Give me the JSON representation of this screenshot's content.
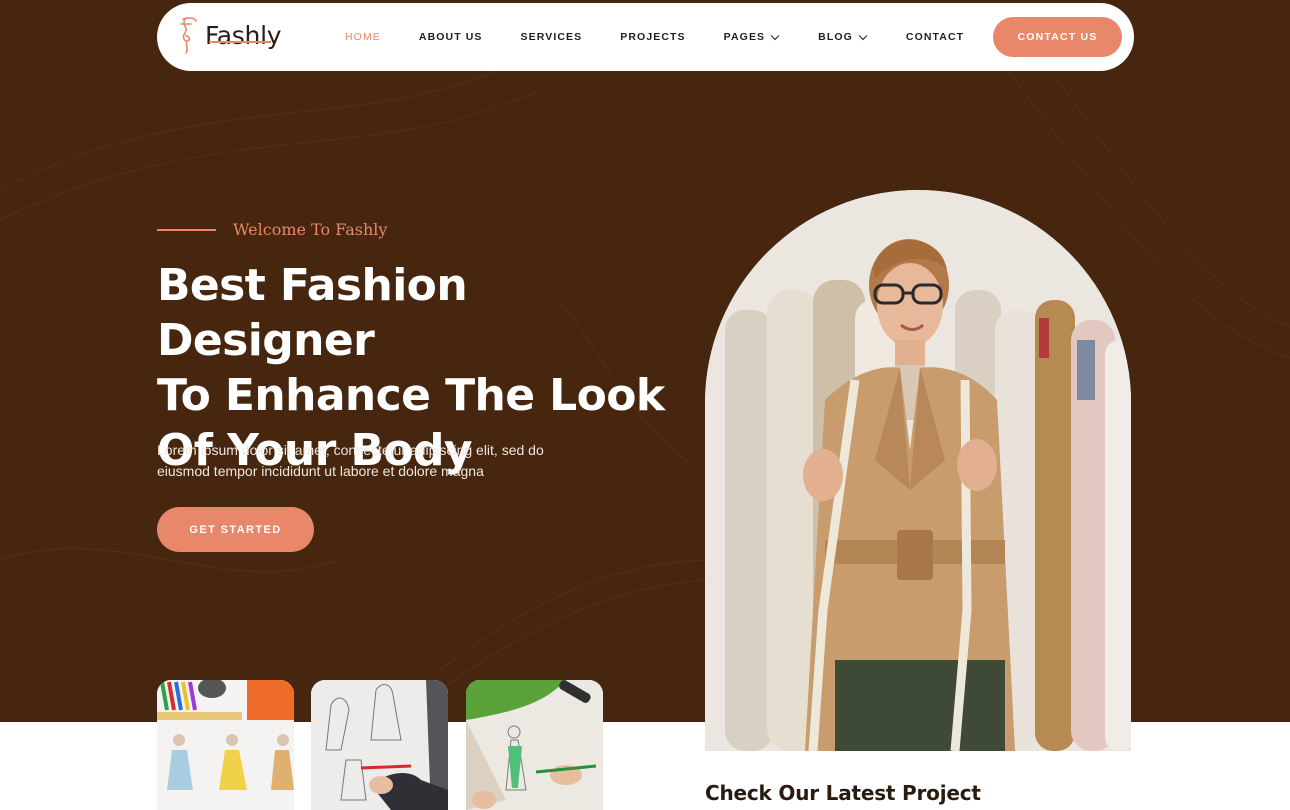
{
  "brand": {
    "name": "Fashly"
  },
  "nav": {
    "items": [
      {
        "label": "HOME",
        "active": true
      },
      {
        "label": "ABOUT US"
      },
      {
        "label": "SERVICES"
      },
      {
        "label": "PROJECTS"
      },
      {
        "label": "PAGES",
        "dropdown": true
      },
      {
        "label": "BLOG",
        "dropdown": true
      },
      {
        "label": "CONTACT"
      }
    ],
    "cta_label": "CONTACT US"
  },
  "hero": {
    "eyebrow": "Welcome To Fashly",
    "headline_lines": [
      "Best Fashion Designer",
      "To Enhance The Look",
      "Of Your Body"
    ],
    "subtext_lines": [
      "Lorem ipsum dolor sit amet, consectetur adipiscing elit, sed do",
      "eiusmod tempor incididunt ut labore et dolore magna"
    ],
    "cta_label": "GET STARTED"
  },
  "projects": {
    "title": "Check Our Latest Project"
  },
  "colors": {
    "hero_bg": "#46260f",
    "accent": "#e8876a",
    "white": "#ffffff"
  },
  "icons": {
    "logo": "dress-form-logo-icon",
    "dropdown": "chevron-down-icon"
  }
}
